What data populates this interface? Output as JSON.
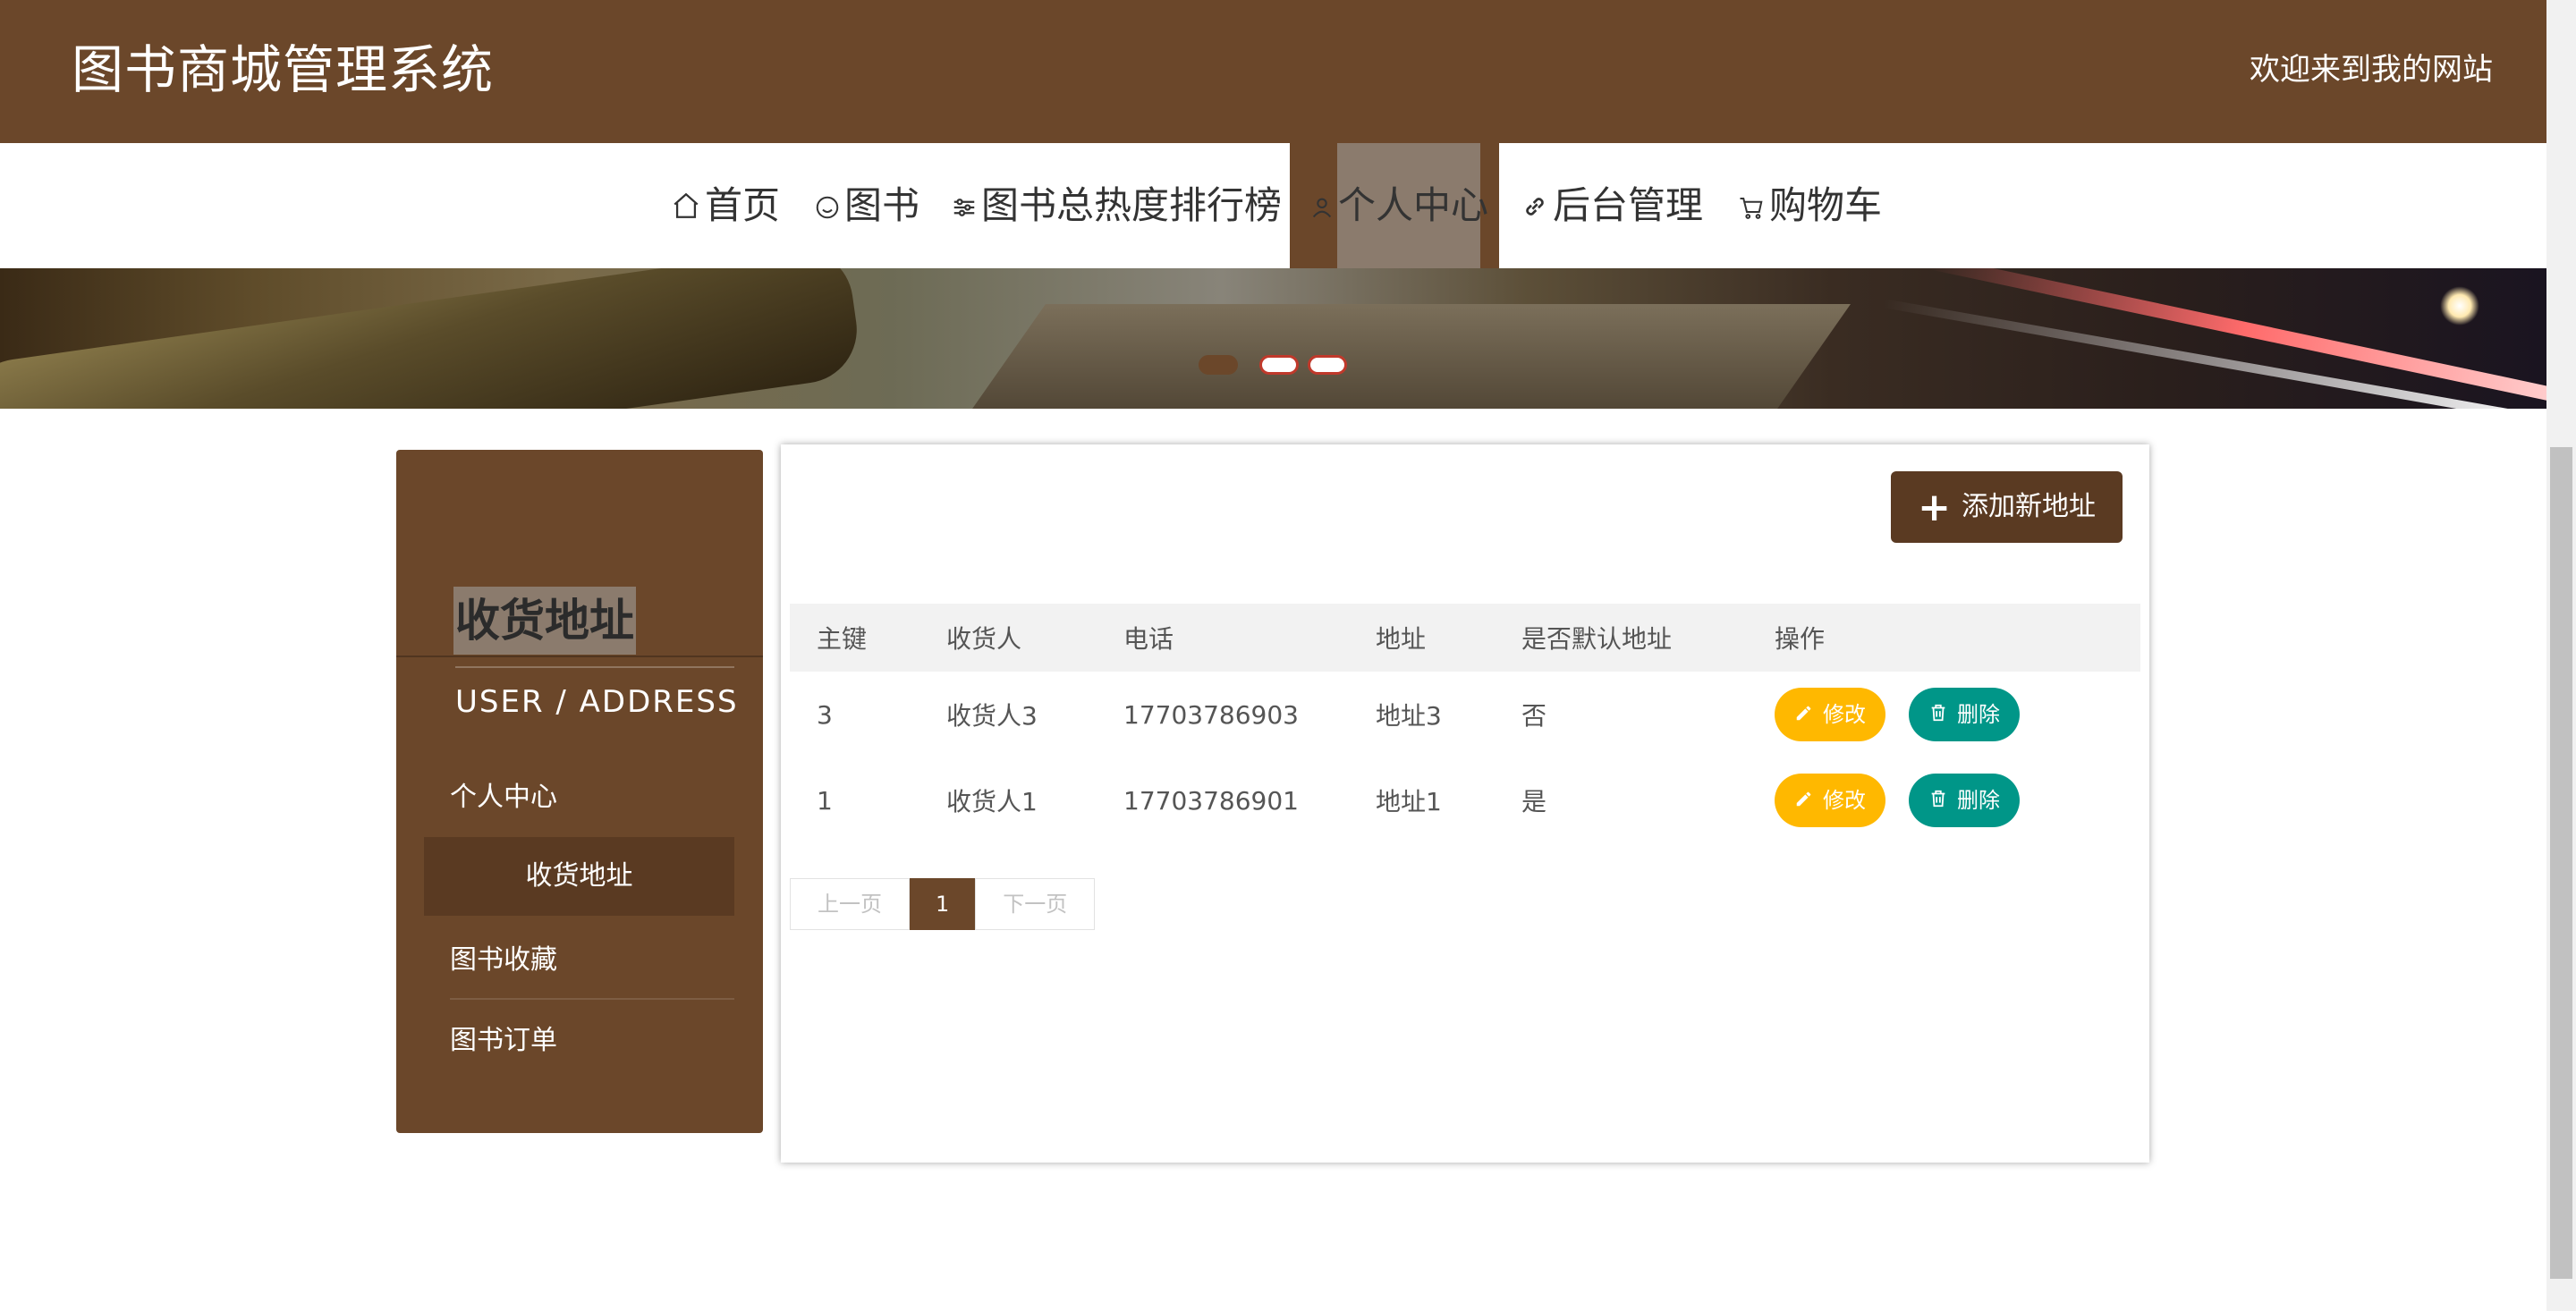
{
  "header": {
    "site_title": "图书商城管理系统",
    "welcome": "欢迎来到我的网站",
    "bg_color": "#6b472a"
  },
  "nav": {
    "items": [
      {
        "label": "首页",
        "icon": "home-icon"
      },
      {
        "label": "图书",
        "icon": "smile-icon"
      },
      {
        "label": "图书总热度排行榜",
        "icon": "sliders-icon"
      },
      {
        "label": "个人中心",
        "icon": "user-icon",
        "active": true
      },
      {
        "label": "后台管理",
        "icon": "link-icon"
      },
      {
        "label": "购物车",
        "icon": "cart-icon"
      }
    ]
  },
  "carousel": {
    "slide_count": 3,
    "active_index": 0
  },
  "sidebar": {
    "title": "收货地址",
    "subtitle": "USER / ADDRESS",
    "items": [
      {
        "label": "个人中心"
      },
      {
        "label": "收货地址",
        "active": true
      },
      {
        "label": "图书收藏"
      },
      {
        "label": "图书订单"
      }
    ]
  },
  "main": {
    "add_button": "添加新地址",
    "columns": [
      "主键",
      "收货人",
      "电话",
      "地址",
      "是否默认地址",
      "操作"
    ],
    "rows": [
      {
        "id": "3",
        "receiver": "收货人3",
        "phone": "17703786903",
        "address": "地址3",
        "is_default": "否"
      },
      {
        "id": "1",
        "receiver": "收货人1",
        "phone": "17703786901",
        "address": "地址1",
        "is_default": "是"
      }
    ],
    "edit_label": "修改",
    "delete_label": "删除",
    "pagination": {
      "prev": "上一页",
      "current": "1",
      "next": "下一页"
    }
  },
  "colors": {
    "accent": "#6b472a",
    "edit": "#ffb800",
    "delete": "#009688"
  }
}
